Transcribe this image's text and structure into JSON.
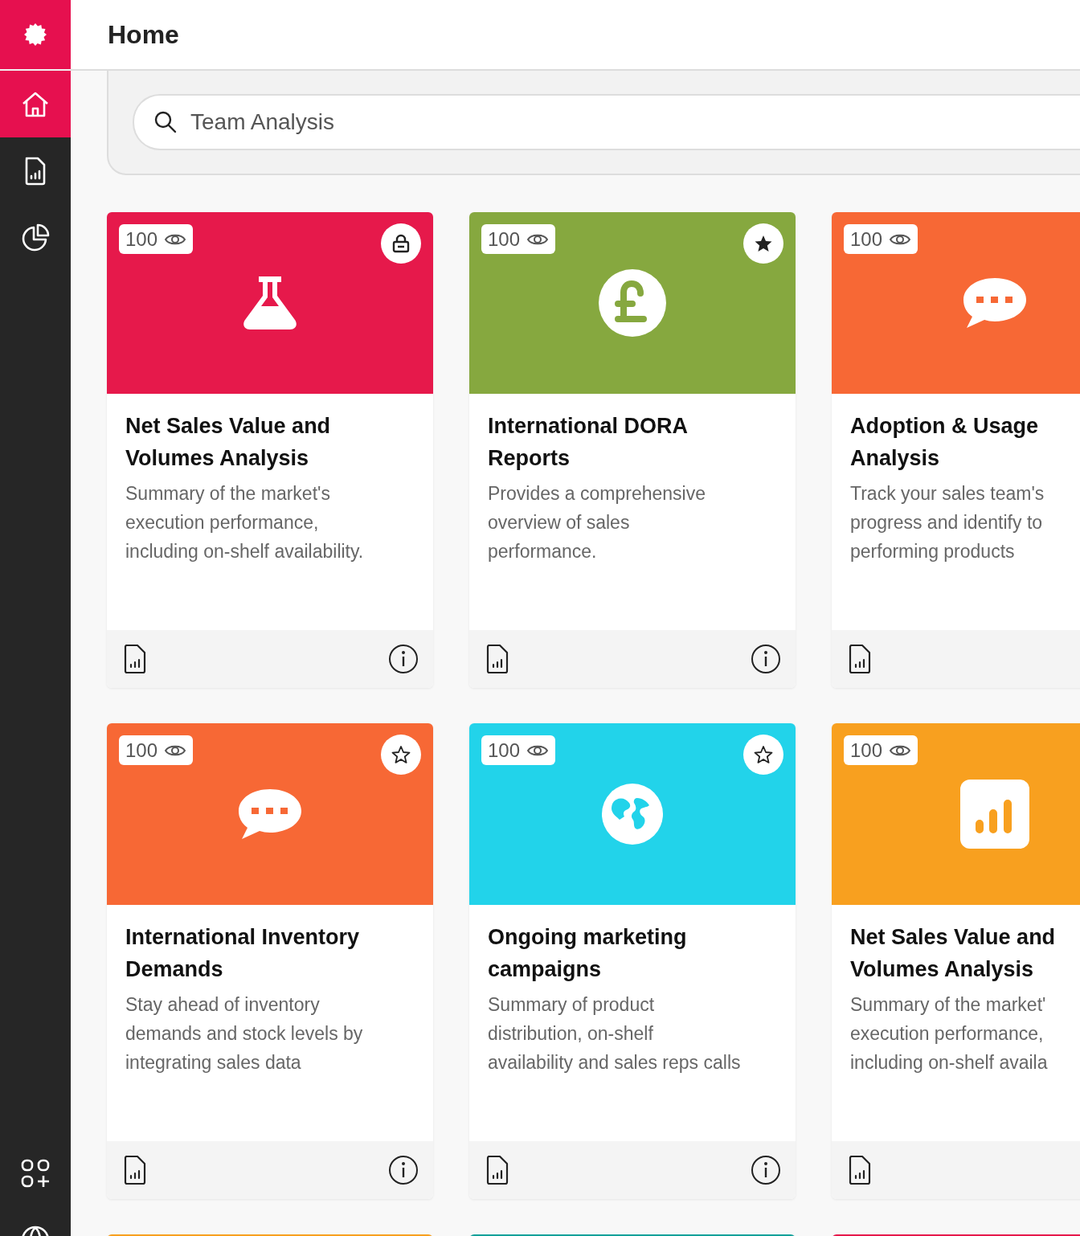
{
  "header": {
    "title": "Home"
  },
  "sidebar": {
    "items": [
      {
        "kind": "home",
        "selected": true
      },
      {
        "kind": "report",
        "selected": false
      },
      {
        "kind": "pie",
        "selected": false
      }
    ],
    "bottom_items": [
      {
        "kind": "apps"
      },
      {
        "kind": "globe"
      }
    ]
  },
  "search": {
    "value": "Team Analysis"
  },
  "cards": [
    {
      "color": "#e6194b",
      "views": "100",
      "kind": "flask",
      "badge": {
        "kind": "lock"
      },
      "title": [
        "Net Sales Value and",
        "Volumes Analysis"
      ],
      "description": [
        "Summary of the market's",
        "execution performance,",
        "including on-shelf availability."
      ]
    },
    {
      "color": "#86a83f",
      "views": "100",
      "kind": "pound",
      "badge": {
        "kind": "star-filled"
      },
      "title": [
        "International DORA",
        "Reports"
      ],
      "description": [
        "Provides a comprehensive",
        "overview of sales",
        "performance."
      ]
    },
    {
      "color": "#f76835",
      "views": "100",
      "kind": "chat",
      "title": [
        "Adoption & Usage",
        "Analysis"
      ],
      "description": [
        "Track your sales team's",
        "progress and identify to",
        "performing products"
      ]
    },
    {
      "color": "#f76835",
      "views": "100",
      "kind": "chat",
      "badge": {
        "kind": "star-outline"
      },
      "title": [
        "International Inventory",
        "Demands"
      ],
      "description": [
        "Stay ahead of inventory",
        "demands and stock levels by",
        "integrating sales data"
      ]
    },
    {
      "color": "#22d3ea",
      "views": "100",
      "kind": "globe",
      "badge": {
        "kind": "star-outline"
      },
      "title": [
        "Ongoing marketing",
        "campaigns"
      ],
      "description": [
        "Summary of product",
        "distribution, on-shelf",
        "availability and sales reps calls"
      ]
    },
    {
      "color": "#f8a01f",
      "views": "100",
      "kind": "chart",
      "title": [
        "Net Sales Value and",
        "Volumes Analysis"
      ],
      "description": [
        "Summary of the market'",
        "execution performance,",
        "including on-shelf availa"
      ]
    }
  ],
  "next_cards": [
    {
      "color": "#f8a01f"
    },
    {
      "color": "#14a19a"
    },
    {
      "color": "#e6194b"
    }
  ]
}
